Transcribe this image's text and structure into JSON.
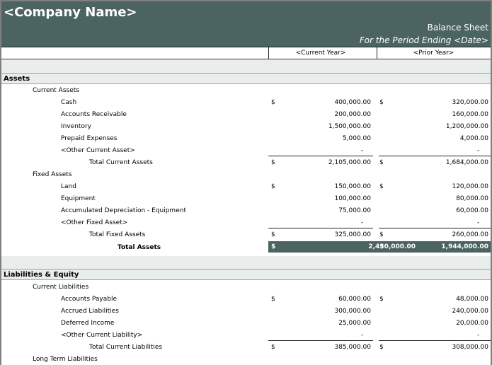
{
  "header": {
    "company": "<Company Name>",
    "title": "Balance Sheet",
    "period": "For the Period Ending <Date>"
  },
  "columns": {
    "current": "<Current Year>",
    "prior": "<Prior Year>"
  },
  "currency": "$",
  "dash": "-",
  "assets": {
    "title": "Assets",
    "current_group": "Current Assets",
    "current_items": [
      {
        "label": "Cash",
        "cur": "400,000.00",
        "prior": "320,000.00"
      },
      {
        "label": "Accounts Receivable",
        "cur": "200,000.00",
        "prior": "160,000.00"
      },
      {
        "label": "Inventory",
        "cur": "1,500,000.00",
        "prior": "1,200,000.00"
      },
      {
        "label": "Prepaid Expenses",
        "cur": "5,000.00",
        "prior": "4,000.00"
      },
      {
        "label": "<Other Current Asset>",
        "cur": "-",
        "prior": "-"
      }
    ],
    "total_current": {
      "label": "Total Current Assets",
      "cur": "2,105,000.00",
      "prior": "1,684,000.00"
    },
    "fixed_group": "Fixed Assets",
    "fixed_items": [
      {
        "label": "Land",
        "cur": "150,000.00",
        "prior": "120,000.00"
      },
      {
        "label": "Equipment",
        "cur": "100,000.00",
        "prior": "80,000.00"
      },
      {
        "label": "Accumulated Depreciation - Equipment",
        "cur": "75,000.00",
        "prior": "60,000.00"
      },
      {
        "label": "<Other Fixed Asset>",
        "cur": "-",
        "prior": "-"
      }
    ],
    "total_fixed": {
      "label": "Total Fixed Assets",
      "cur": "325,000.00",
      "prior": "260,000.00"
    },
    "total": {
      "label": "Total Assets",
      "cur": "2,430,000.00",
      "prior": "1,944,000.00"
    }
  },
  "liabilities": {
    "title": "Liabilities & Equity",
    "current_group": "Current Liabilities",
    "current_items": [
      {
        "label": "Accounts Payable",
        "cur": "60,000.00",
        "prior": "48,000.00"
      },
      {
        "label": "Accrued Liabilities",
        "cur": "300,000.00",
        "prior": "240,000.00"
      },
      {
        "label": "Deferred Income",
        "cur": "25,000.00",
        "prior": "20,000.00"
      },
      {
        "label": "<Other Current Liability>",
        "cur": "-",
        "prior": "-"
      }
    ],
    "total_current": {
      "label": "Total Current Liabilities",
      "cur": "385,000.00",
      "prior": "308,000.00"
    },
    "long_term_group": "Long Term Liabilities"
  }
}
